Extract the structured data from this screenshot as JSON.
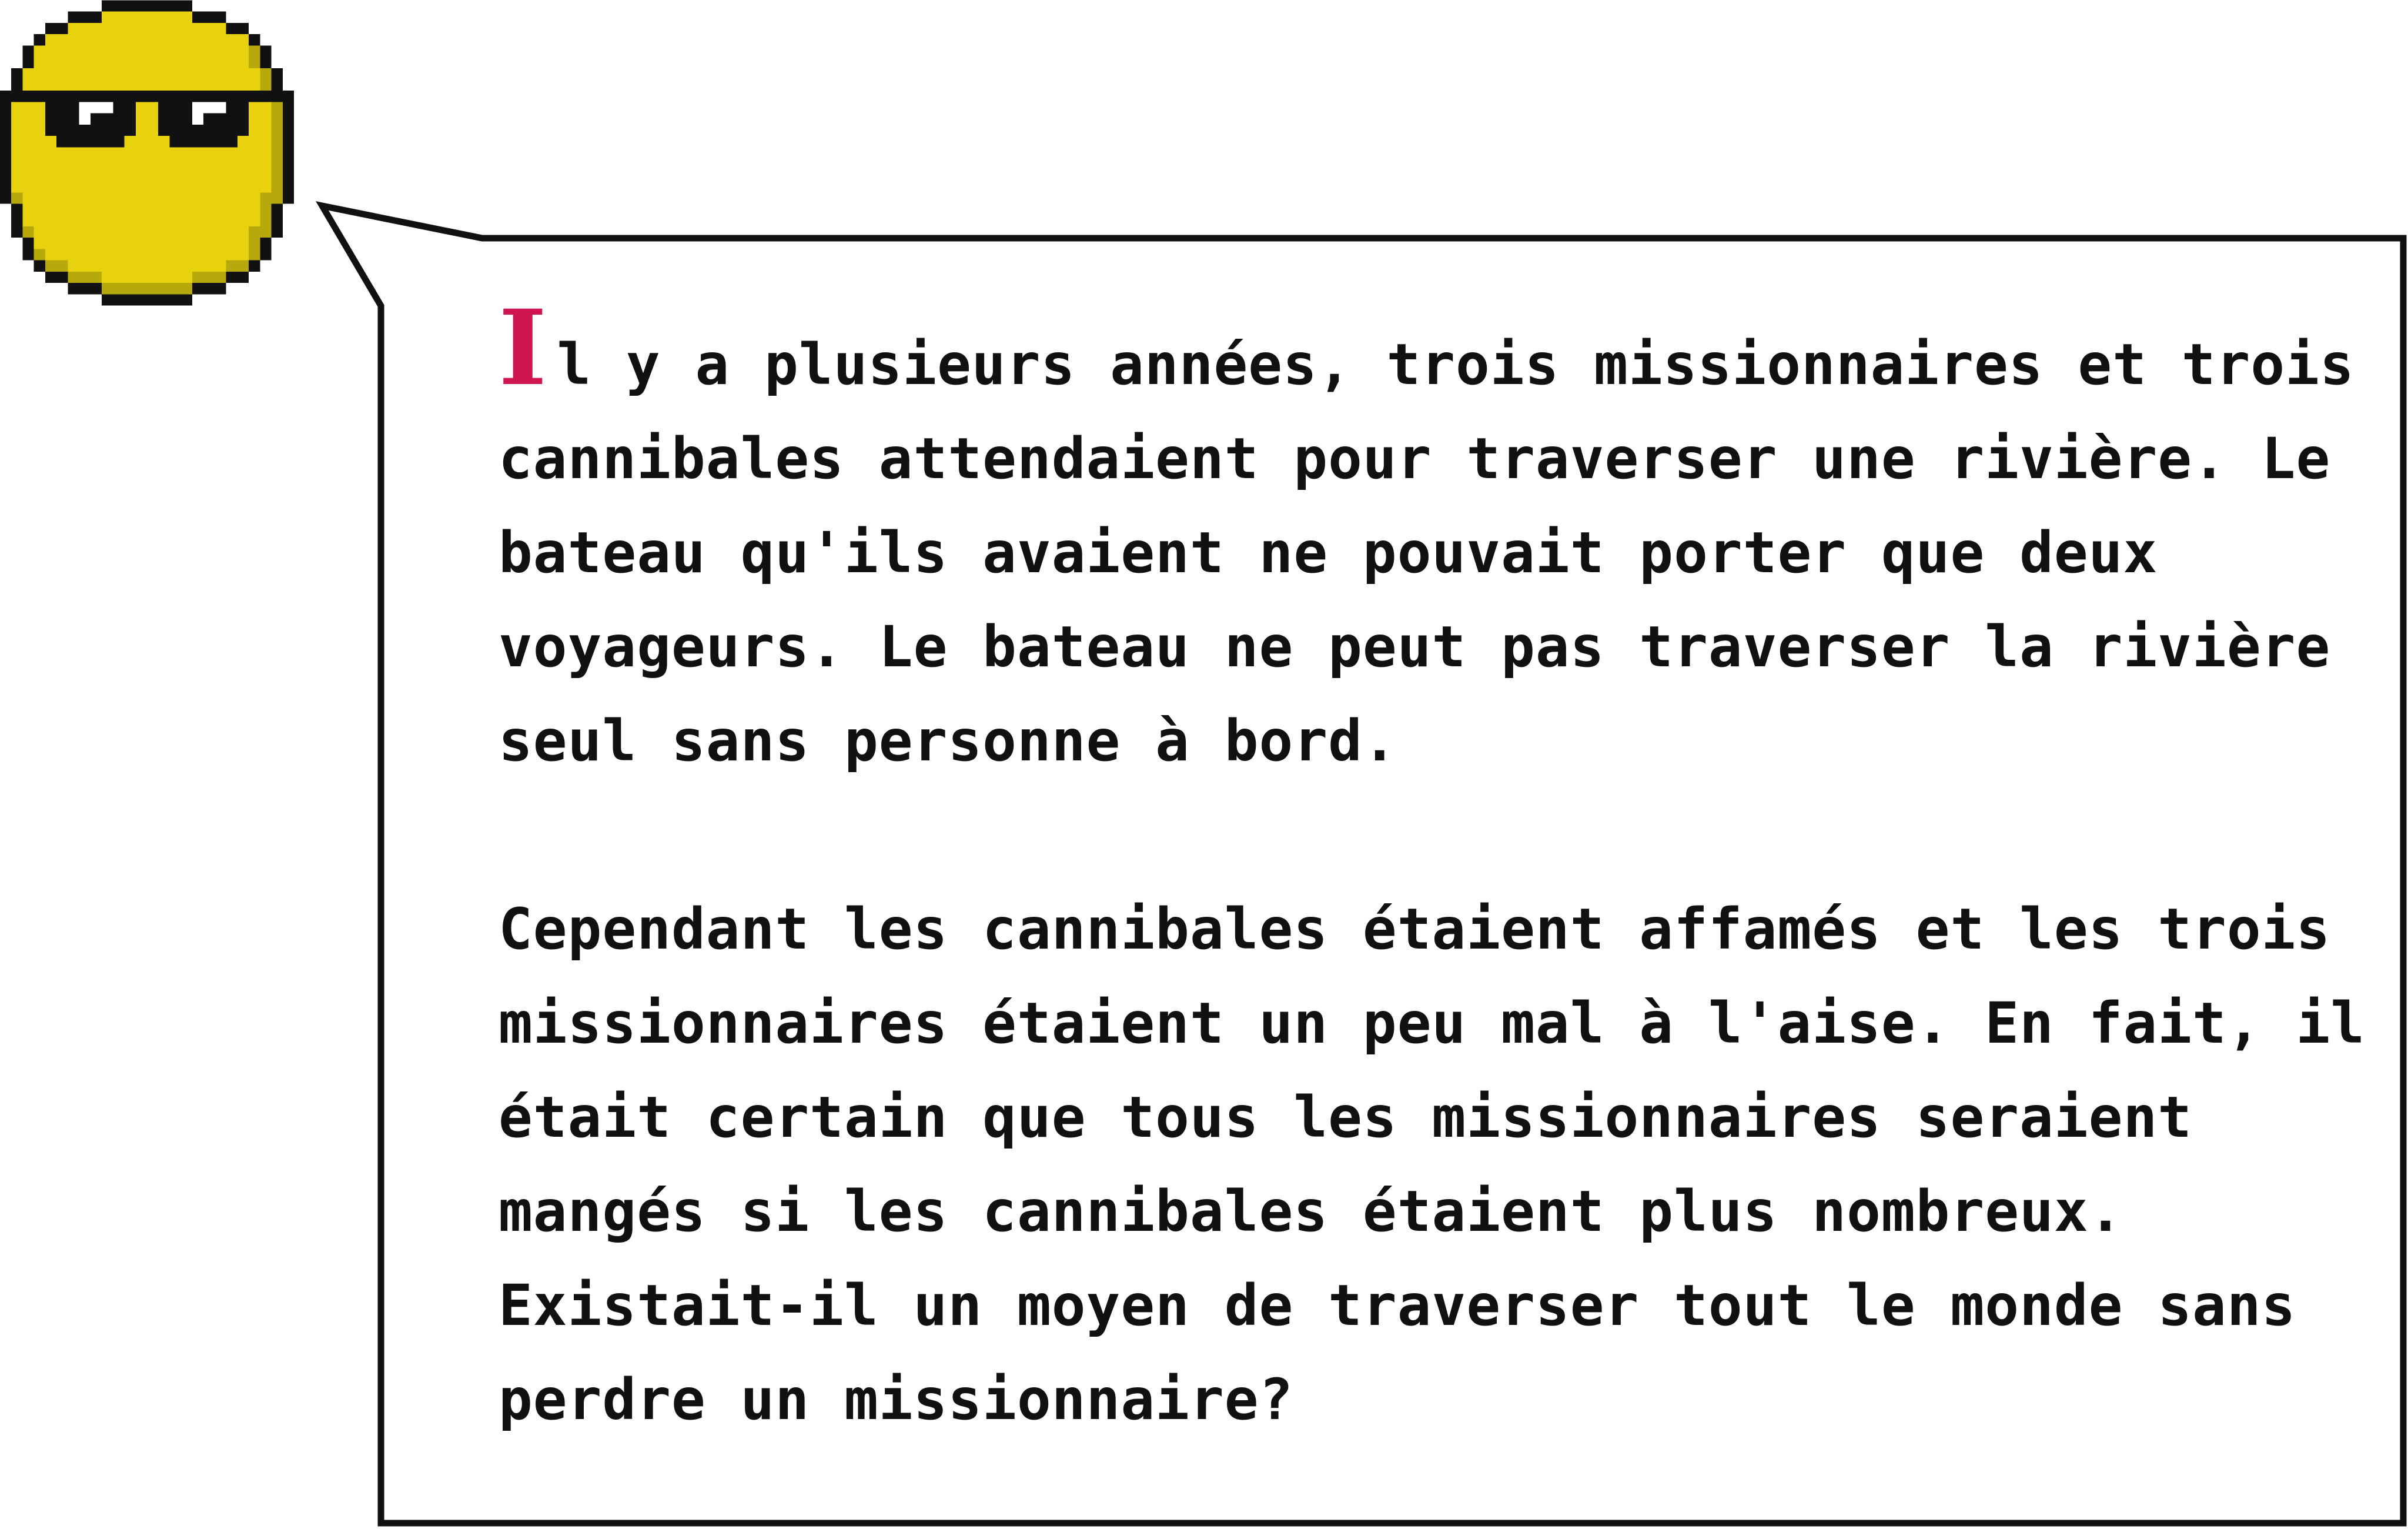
{
  "speaker": {
    "avatar_icon": "sunglasses-smiley-icon",
    "face_color": "#e8d20e",
    "shadow_color": "#b7a80c",
    "outline_color": "#111111"
  },
  "speech_bubble": {
    "border_color": "#111111",
    "drop_cap": "I",
    "drop_cap_color": "#d0164f",
    "paragraphs": [
      "l y a plusieurs années, trois missionnaires et trois cannibales attendaient pour traverser une rivière. Le bateau qu'ils avaient ne pouvait porter que deux voyageurs. Le bateau ne peut pas traverser la rivière seul sans personne à bord.",
      "Cependant les cannibales étaient affamés et les trois missionnaires étaient un peu mal à l'aise. En fait, il était certain que tous les missionnaires seraient mangés si les cannibales étaient plus nombreux.",
      "Existait-il un moyen de traverser tout le monde sans perdre un missionnaire?"
    ]
  }
}
